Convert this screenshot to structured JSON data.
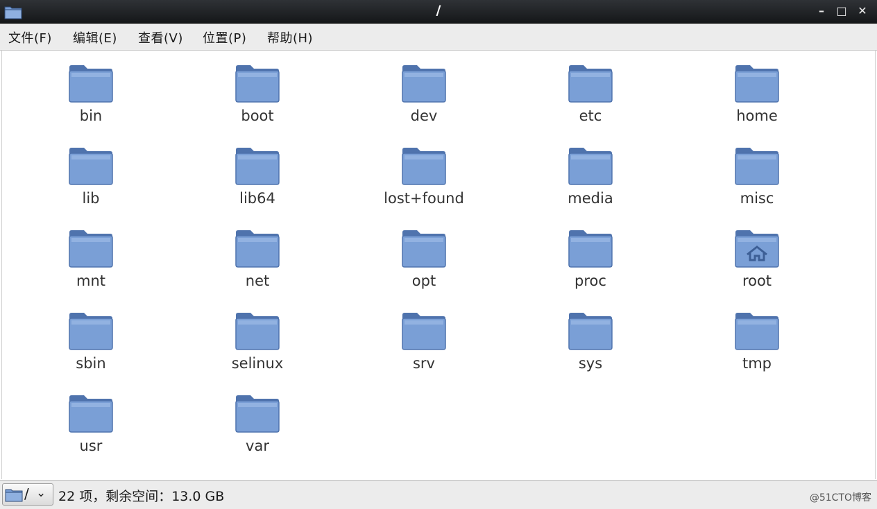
{
  "window": {
    "title": "/",
    "icon": "folder-icon",
    "controls": {
      "minimize": "–",
      "maximize": "□",
      "close": "✕"
    }
  },
  "menu": [
    {
      "label": "文件(F)"
    },
    {
      "label": "编辑(E)"
    },
    {
      "label": "查看(V)"
    },
    {
      "label": "位置(P)"
    },
    {
      "label": "帮助(H)"
    }
  ],
  "folders": [
    {
      "label": "bin",
      "icon": "folder-icon"
    },
    {
      "label": "boot",
      "icon": "folder-icon"
    },
    {
      "label": "dev",
      "icon": "folder-icon"
    },
    {
      "label": "etc",
      "icon": "folder-icon"
    },
    {
      "label": "home",
      "icon": "folder-icon"
    },
    {
      "label": "lib",
      "icon": "folder-icon"
    },
    {
      "label": "lib64",
      "icon": "folder-icon"
    },
    {
      "label": "lost+found",
      "icon": "folder-icon"
    },
    {
      "label": "media",
      "icon": "folder-icon"
    },
    {
      "label": "misc",
      "icon": "folder-icon"
    },
    {
      "label": "mnt",
      "icon": "folder-icon"
    },
    {
      "label": "net",
      "icon": "folder-icon"
    },
    {
      "label": "opt",
      "icon": "folder-icon"
    },
    {
      "label": "proc",
      "icon": "folder-icon"
    },
    {
      "label": "root",
      "icon": "home-folder-icon"
    },
    {
      "label": "sbin",
      "icon": "folder-icon"
    },
    {
      "label": "selinux",
      "icon": "folder-icon"
    },
    {
      "label": "srv",
      "icon": "folder-icon"
    },
    {
      "label": "sys",
      "icon": "folder-icon"
    },
    {
      "label": "tmp",
      "icon": "folder-icon"
    },
    {
      "label": "usr",
      "icon": "folder-icon"
    },
    {
      "label": "var",
      "icon": "folder-icon"
    }
  ],
  "status": {
    "location": "/",
    "location_icon": "folder-icon",
    "dropdown_icon": "chevron-down-icon",
    "summary": "22 项，剩余空间：13.0 GB",
    "watermark": "@51CTO博客"
  },
  "colors": {
    "folder_body": "#7a9fd6",
    "folder_edge": "#4f73ad",
    "titlebar": "#1f2225",
    "menubar": "#ececec"
  }
}
